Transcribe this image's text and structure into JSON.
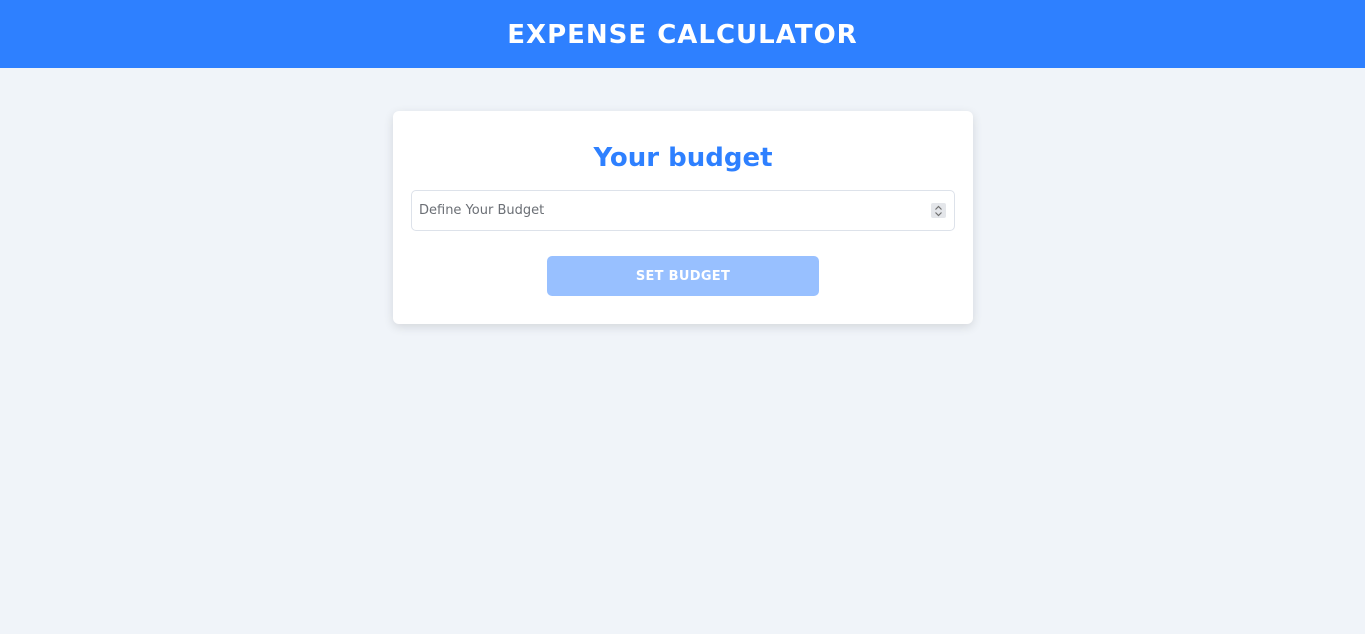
{
  "header": {
    "title": "EXPENSE CALCULATOR"
  },
  "budget_card": {
    "title": "Your budget",
    "input": {
      "placeholder": "Define Your Budget",
      "value": ""
    },
    "submit_label": "SET BUDGET",
    "submit_state": "disabled"
  },
  "icons": {
    "spinner": "number-spinner-icon"
  },
  "colors": {
    "brand": "#2e80ff",
    "background": "#f0f4f9",
    "button_disabled": "#98c0ff",
    "card": "#ffffff"
  }
}
